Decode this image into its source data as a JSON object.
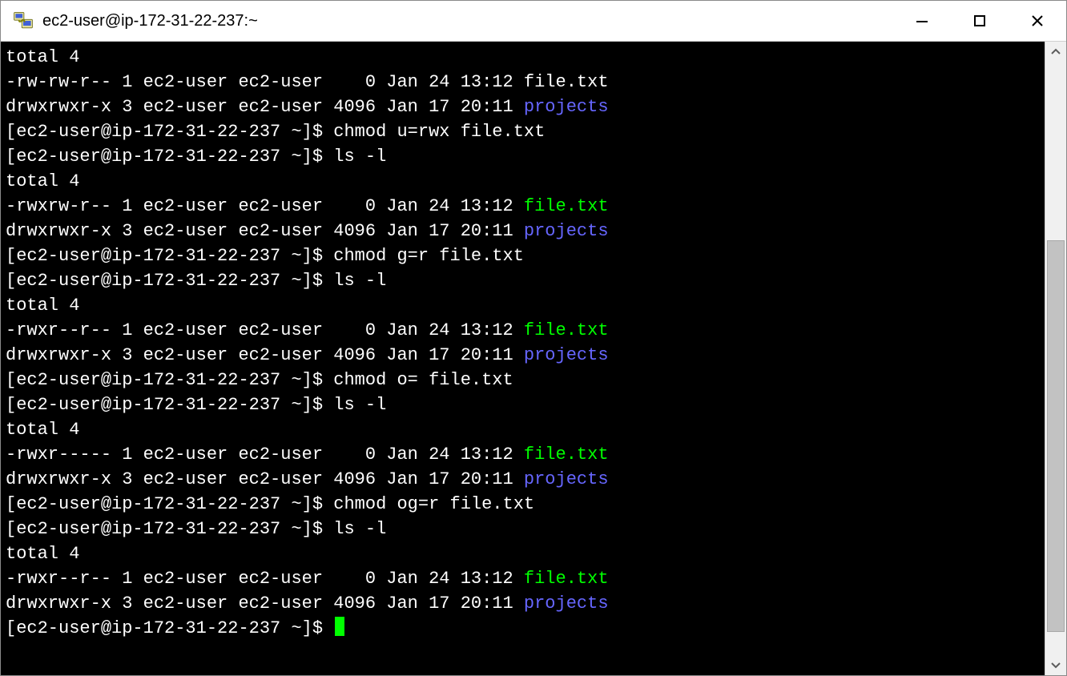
{
  "window": {
    "title": "ec2-user@ip-172-31-22-237:~"
  },
  "controls": {
    "minimize": "minimize",
    "maximize": "maximize",
    "close": "close"
  },
  "prompt": "[ec2-user@ip-172-31-22-237 ~]$ ",
  "terminal_lines": [
    {
      "segments": [
        {
          "t": "total 4",
          "c": ""
        }
      ]
    },
    {
      "segments": [
        {
          "t": "-rw-rw-r-- 1 ec2-user ec2-user    0 Jan 24 13:12 file.txt",
          "c": ""
        }
      ]
    },
    {
      "segments": [
        {
          "t": "drwxrwxr-x 3 ec2-user ec2-user 4096 Jan 17 20:11 ",
          "c": ""
        },
        {
          "t": "projects",
          "c": "dir"
        }
      ]
    },
    {
      "segments": [
        {
          "t": "[ec2-user@ip-172-31-22-237 ~]$ chmod u=rwx file.txt",
          "c": ""
        }
      ]
    },
    {
      "segments": [
        {
          "t": "[ec2-user@ip-172-31-22-237 ~]$ ls -l",
          "c": ""
        }
      ]
    },
    {
      "segments": [
        {
          "t": "total 4",
          "c": ""
        }
      ]
    },
    {
      "segments": [
        {
          "t": "-rwxrw-r-- 1 ec2-user ec2-user    0 Jan 24 13:12 ",
          "c": ""
        },
        {
          "t": "file.txt",
          "c": "exec"
        }
      ]
    },
    {
      "segments": [
        {
          "t": "drwxrwxr-x 3 ec2-user ec2-user 4096 Jan 17 20:11 ",
          "c": ""
        },
        {
          "t": "projects",
          "c": "dir"
        }
      ]
    },
    {
      "segments": [
        {
          "t": "[ec2-user@ip-172-31-22-237 ~]$ chmod g=r file.txt",
          "c": ""
        }
      ]
    },
    {
      "segments": [
        {
          "t": "[ec2-user@ip-172-31-22-237 ~]$ ls -l",
          "c": ""
        }
      ]
    },
    {
      "segments": [
        {
          "t": "total 4",
          "c": ""
        }
      ]
    },
    {
      "segments": [
        {
          "t": "-rwxr--r-- 1 ec2-user ec2-user    0 Jan 24 13:12 ",
          "c": ""
        },
        {
          "t": "file.txt",
          "c": "exec"
        }
      ]
    },
    {
      "segments": [
        {
          "t": "drwxrwxr-x 3 ec2-user ec2-user 4096 Jan 17 20:11 ",
          "c": ""
        },
        {
          "t": "projects",
          "c": "dir"
        }
      ]
    },
    {
      "segments": [
        {
          "t": "[ec2-user@ip-172-31-22-237 ~]$ chmod o= file.txt",
          "c": ""
        }
      ]
    },
    {
      "segments": [
        {
          "t": "[ec2-user@ip-172-31-22-237 ~]$ ls -l",
          "c": ""
        }
      ]
    },
    {
      "segments": [
        {
          "t": "total 4",
          "c": ""
        }
      ]
    },
    {
      "segments": [
        {
          "t": "-rwxr----- 1 ec2-user ec2-user    0 Jan 24 13:12 ",
          "c": ""
        },
        {
          "t": "file.txt",
          "c": "exec"
        }
      ]
    },
    {
      "segments": [
        {
          "t": "drwxrwxr-x 3 ec2-user ec2-user 4096 Jan 17 20:11 ",
          "c": ""
        },
        {
          "t": "projects",
          "c": "dir"
        }
      ]
    },
    {
      "segments": [
        {
          "t": "[ec2-user@ip-172-31-22-237 ~]$ chmod og=r file.txt",
          "c": ""
        }
      ]
    },
    {
      "segments": [
        {
          "t": "[ec2-user@ip-172-31-22-237 ~]$ ls -l",
          "c": ""
        }
      ]
    },
    {
      "segments": [
        {
          "t": "total 4",
          "c": ""
        }
      ]
    },
    {
      "segments": [
        {
          "t": "-rwxr--r-- 1 ec2-user ec2-user    0 Jan 24 13:12 ",
          "c": ""
        },
        {
          "t": "file.txt",
          "c": "exec"
        }
      ]
    },
    {
      "segments": [
        {
          "t": "drwxrwxr-x 3 ec2-user ec2-user 4096 Jan 17 20:11 ",
          "c": ""
        },
        {
          "t": "projects",
          "c": "dir"
        }
      ]
    },
    {
      "segments": [
        {
          "t": "[ec2-user@ip-172-31-22-237 ~]$ ",
          "c": ""
        }
      ],
      "cursor": true
    }
  ]
}
